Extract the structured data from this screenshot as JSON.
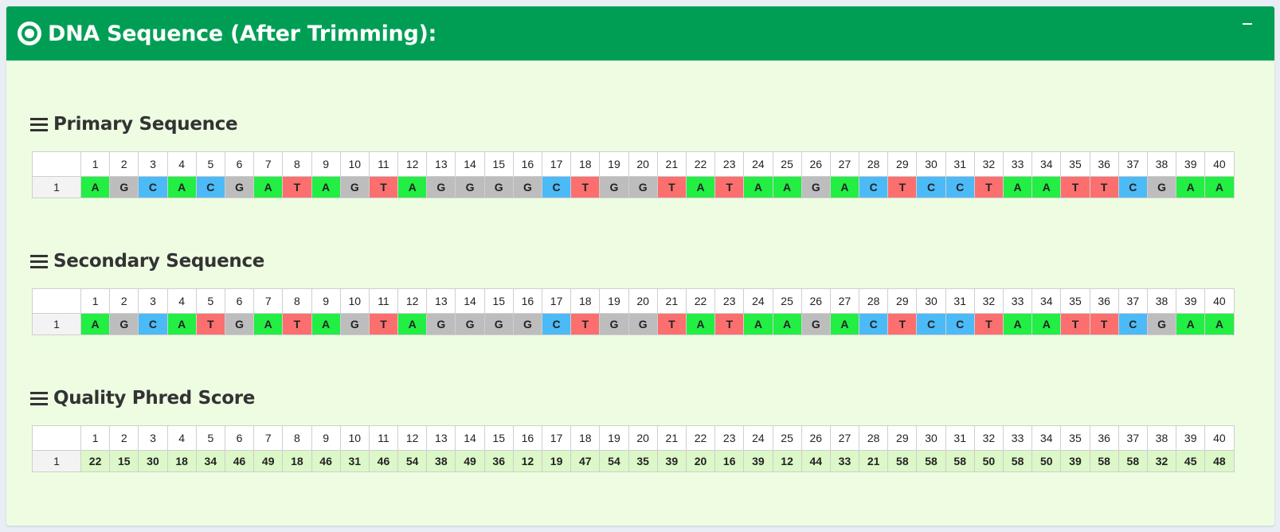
{
  "panel": {
    "title": "DNA Sequence (After Trimming):",
    "collapse_label": "−"
  },
  "colors": {
    "header": "#009e55",
    "A": "#22ee44",
    "C": "#4cbaf7",
    "G": "#bdbdbd",
    "T": "#fb6f6f",
    "quality": "#dcf7c8"
  },
  "columns": [
    1,
    2,
    3,
    4,
    5,
    6,
    7,
    8,
    9,
    10,
    11,
    12,
    13,
    14,
    15,
    16,
    17,
    18,
    19,
    20,
    21,
    22,
    23,
    24,
    25,
    26,
    27,
    28,
    29,
    30,
    31,
    32,
    33,
    34,
    35,
    36,
    37,
    38,
    39,
    40
  ],
  "primary": {
    "title": "Primary Sequence",
    "row_label": "1",
    "bases": [
      "A",
      "G",
      "C",
      "A",
      "C",
      "G",
      "A",
      "T",
      "A",
      "G",
      "T",
      "A",
      "G",
      "G",
      "G",
      "G",
      "C",
      "T",
      "G",
      "G",
      "T",
      "A",
      "T",
      "A",
      "A",
      "G",
      "A",
      "C",
      "T",
      "C",
      "C",
      "T",
      "A",
      "A",
      "T",
      "T",
      "C",
      "G",
      "A",
      "A"
    ]
  },
  "secondary": {
    "title": "Secondary Sequence",
    "row_label": "1",
    "bases": [
      "A",
      "G",
      "C",
      "A",
      "T",
      "G",
      "A",
      "T",
      "A",
      "G",
      "T",
      "A",
      "G",
      "G",
      "G",
      "G",
      "C",
      "T",
      "G",
      "G",
      "T",
      "A",
      "T",
      "A",
      "A",
      "G",
      "A",
      "C",
      "T",
      "C",
      "C",
      "T",
      "A",
      "A",
      "T",
      "T",
      "C",
      "G",
      "A",
      "A"
    ]
  },
  "quality": {
    "title": "Quality Phred Score",
    "row_label": "1",
    "scores": [
      22,
      15,
      30,
      18,
      34,
      46,
      49,
      18,
      46,
      31,
      46,
      54,
      38,
      49,
      36,
      12,
      19,
      47,
      54,
      35,
      39,
      20,
      16,
      39,
      12,
      44,
      33,
      21,
      58,
      58,
      58,
      50,
      58,
      50,
      39,
      58,
      58,
      32,
      45,
      48
    ]
  }
}
